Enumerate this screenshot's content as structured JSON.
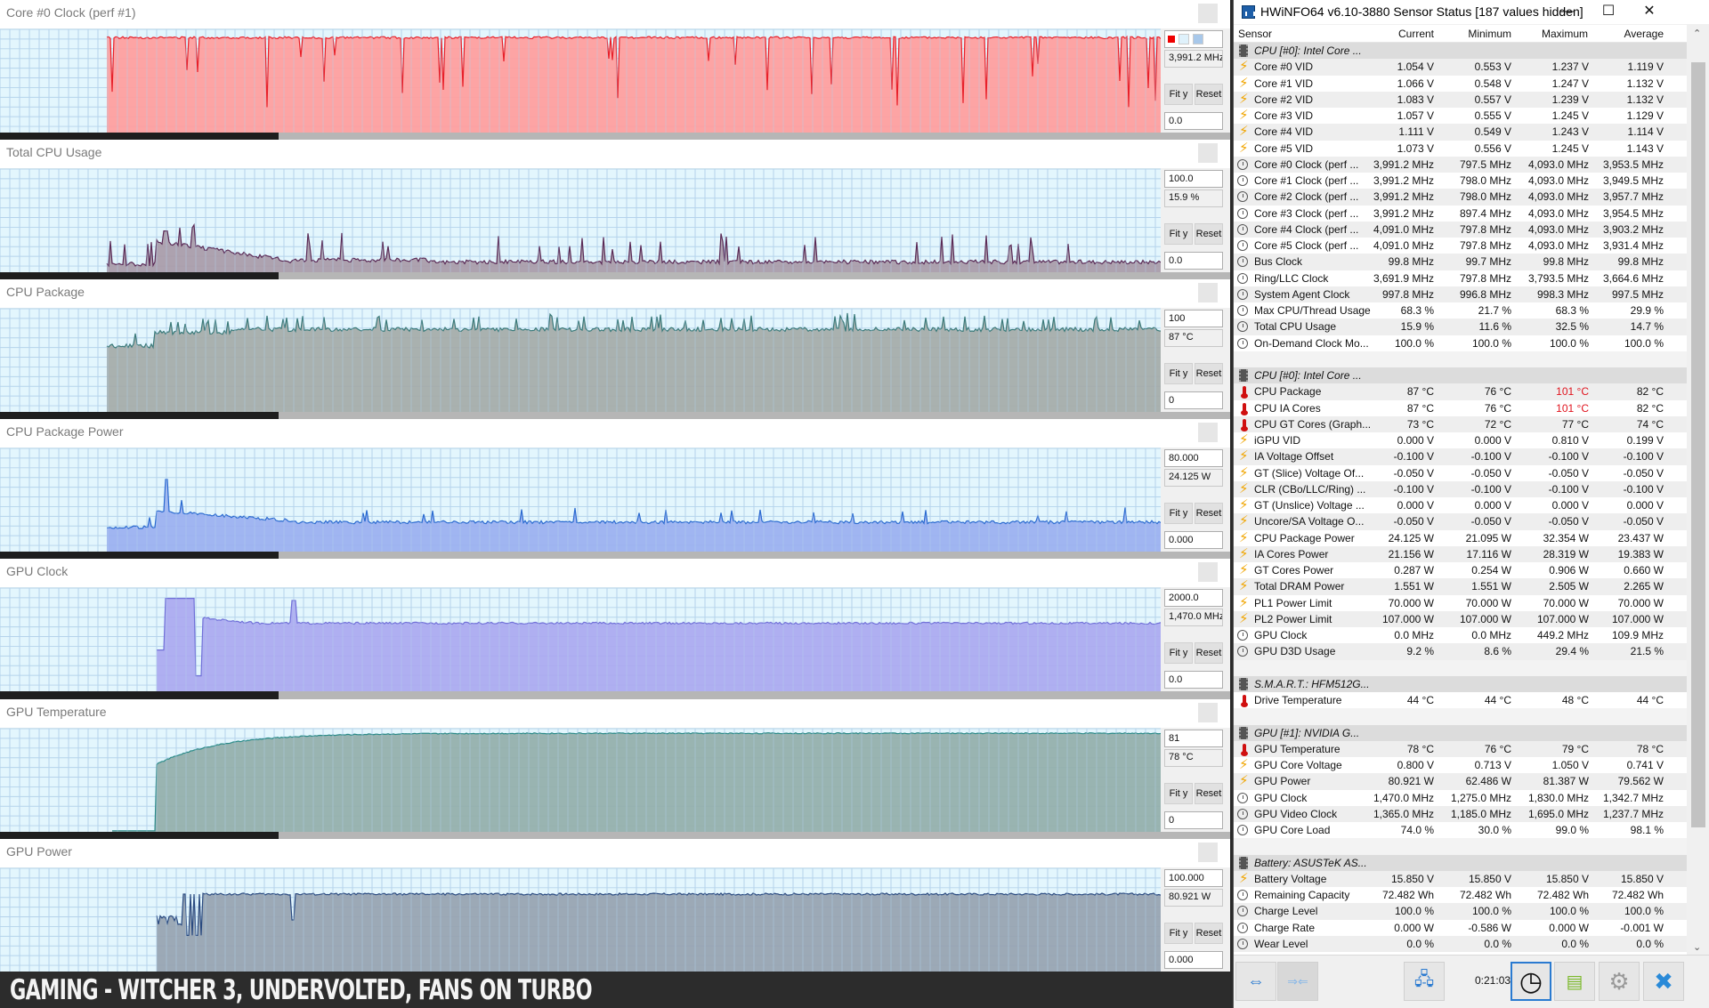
{
  "graphs": [
    {
      "title": "Core #0 Clock (perf #1)",
      "max": "",
      "current": "3,991.2 MHz",
      "min": "0.0",
      "fit_label": "Fit y",
      "reset_label": "Reset",
      "fill": "#ff9c9c",
      "line": "#e8202a",
      "series_kind": "clock",
      "has_color_swatch": true
    },
    {
      "title": "Total CPU Usage",
      "max": "100.0",
      "current": "15.9 %",
      "min": "0.0",
      "fit_label": "Fit y",
      "reset_label": "Reset",
      "fill": "#a89aa8",
      "line": "#5a2a56",
      "series_kind": "cpuusage"
    },
    {
      "title": "CPU Package",
      "max": "100",
      "current": "87 °C",
      "min": "0",
      "fit_label": "Fit y",
      "reset_label": "Reset",
      "fill": "#a4aaa8",
      "line": "#3a7a7a",
      "series_kind": "cputemp"
    },
    {
      "title": "CPU Package Power",
      "max": "80.000",
      "current": "24.125 W",
      "min": "0.000",
      "fit_label": "Fit y",
      "reset_label": "Reset",
      "fill": "#9aaff0",
      "line": "#2a6ad0",
      "series_kind": "cpupower"
    },
    {
      "title": "GPU Clock",
      "max": "2000.0",
      "current": "1,470.0 MHz",
      "min": "0.0",
      "fit_label": "Fit y",
      "reset_label": "Reset",
      "fill": "#aaa8f0",
      "line": "#7070d8",
      "series_kind": "gpuclock"
    },
    {
      "title": "GPU Temperature",
      "max": "81",
      "current": "78 °C",
      "min": "0",
      "fit_label": "Fit y",
      "reset_label": "Reset",
      "fill": "#93aeaa",
      "line": "#2a8a88",
      "series_kind": "gputemp"
    },
    {
      "title": "GPU Power",
      "max": "100.000",
      "current": "80.921 W",
      "min": "0.000",
      "fit_label": "Fit y",
      "reset_label": "Reset",
      "fill": "#96a2b0",
      "line": "#2a4a80",
      "series_kind": "gpupower"
    }
  ],
  "banner": {
    "text": "GAMING - WITCHER 3, UNDERVOLTED, FANS ON TURBO"
  },
  "hwinfo": {
    "title": "HWiNFO64 v6.10-3880 Sensor Status [187 values hidden]",
    "controls": {
      "minimize": "—",
      "maximize": "☐",
      "close": "✕"
    },
    "columns": [
      "Sensor",
      "Current",
      "Minimum",
      "Maximum",
      "Average"
    ],
    "rows": [
      {
        "type": "group",
        "icon": "chip",
        "label": "CPU [#0]: Intel Core ..."
      },
      {
        "icon": "bolt",
        "label": "Core #0 VID",
        "cur": "1.054 V",
        "min": "0.553 V",
        "max": "1.237 V",
        "avg": "1.119 V"
      },
      {
        "icon": "bolt",
        "label": "Core #1 VID",
        "cur": "1.066 V",
        "min": "0.548 V",
        "max": "1.247 V",
        "avg": "1.132 V"
      },
      {
        "icon": "bolt",
        "label": "Core #2 VID",
        "cur": "1.083 V",
        "min": "0.557 V",
        "max": "1.239 V",
        "avg": "1.132 V"
      },
      {
        "icon": "bolt",
        "label": "Core #3 VID",
        "cur": "1.057 V",
        "min": "0.555 V",
        "max": "1.245 V",
        "avg": "1.129 V"
      },
      {
        "icon": "bolt",
        "label": "Core #4 VID",
        "cur": "1.111 V",
        "min": "0.549 V",
        "max": "1.243 V",
        "avg": "1.114 V"
      },
      {
        "icon": "bolt",
        "label": "Core #5 VID",
        "cur": "1.073 V",
        "min": "0.556 V",
        "max": "1.245 V",
        "avg": "1.143 V"
      },
      {
        "icon": "clock",
        "label": "Core #0 Clock (perf ...",
        "cur": "3,991.2 MHz",
        "min": "797.5 MHz",
        "max": "4,093.0 MHz",
        "avg": "3,953.5 MHz"
      },
      {
        "icon": "clock",
        "label": "Core #1 Clock (perf ...",
        "cur": "3,991.2 MHz",
        "min": "798.0 MHz",
        "max": "4,093.0 MHz",
        "avg": "3,949.5 MHz"
      },
      {
        "icon": "clock",
        "label": "Core #2 Clock (perf ...",
        "cur": "3,991.2 MHz",
        "min": "798.0 MHz",
        "max": "4,093.0 MHz",
        "avg": "3,957.7 MHz"
      },
      {
        "icon": "clock",
        "label": "Core #3 Clock (perf ...",
        "cur": "3,991.2 MHz",
        "min": "897.4 MHz",
        "max": "4,093.0 MHz",
        "avg": "3,954.5 MHz"
      },
      {
        "icon": "clock",
        "label": "Core #4 Clock (perf ...",
        "cur": "4,091.0 MHz",
        "min": "797.8 MHz",
        "max": "4,093.0 MHz",
        "avg": "3,903.2 MHz"
      },
      {
        "icon": "clock",
        "label": "Core #5 Clock (perf ...",
        "cur": "4,091.0 MHz",
        "min": "797.8 MHz",
        "max": "4,093.0 MHz",
        "avg": "3,931.4 MHz"
      },
      {
        "icon": "clock",
        "label": "Bus Clock",
        "cur": "99.8 MHz",
        "min": "99.7 MHz",
        "max": "99.8 MHz",
        "avg": "99.8 MHz"
      },
      {
        "icon": "clock",
        "label": "Ring/LLC Clock",
        "cur": "3,691.9 MHz",
        "min": "797.8 MHz",
        "max": "3,793.5 MHz",
        "avg": "3,664.6 MHz"
      },
      {
        "icon": "clock",
        "label": "System Agent Clock",
        "cur": "997.8 MHz",
        "min": "996.8 MHz",
        "max": "998.3 MHz",
        "avg": "997.5 MHz"
      },
      {
        "icon": "clock",
        "label": "Max CPU/Thread Usage",
        "cur": "68.3 %",
        "min": "21.7 %",
        "max": "68.3 %",
        "avg": "29.9 %"
      },
      {
        "icon": "clock",
        "label": "Total CPU Usage",
        "cur": "15.9 %",
        "min": "11.6 %",
        "max": "32.5 %",
        "avg": "14.7 %"
      },
      {
        "icon": "clock",
        "label": "On-Demand Clock Mo...",
        "cur": "100.0 %",
        "min": "100.0 %",
        "max": "100.0 %",
        "avg": "100.0 %"
      },
      {
        "type": "blank"
      },
      {
        "type": "group",
        "icon": "chip",
        "label": "CPU [#0]: Intel Core ..."
      },
      {
        "icon": "therm",
        "label": "CPU Package",
        "cur": "87 °C",
        "min": "76 °C",
        "max": "101 °C",
        "avg": "82 °C",
        "max_alert": true
      },
      {
        "icon": "therm",
        "label": "CPU IA Cores",
        "cur": "87 °C",
        "min": "76 °C",
        "max": "101 °C",
        "avg": "82 °C",
        "max_alert": true
      },
      {
        "icon": "therm",
        "label": "CPU GT Cores (Graph...",
        "cur": "73 °C",
        "min": "72 °C",
        "max": "77 °C",
        "avg": "74 °C"
      },
      {
        "icon": "bolt",
        "label": "iGPU VID",
        "cur": "0.000 V",
        "min": "0.000 V",
        "max": "0.810 V",
        "avg": "0.199 V"
      },
      {
        "icon": "bolt",
        "label": "IA Voltage Offset",
        "cur": "-0.100 V",
        "min": "-0.100 V",
        "max": "-0.100 V",
        "avg": "-0.100 V"
      },
      {
        "icon": "bolt",
        "label": "GT (Slice) Voltage Of...",
        "cur": "-0.050 V",
        "min": "-0.050 V",
        "max": "-0.050 V",
        "avg": "-0.050 V"
      },
      {
        "icon": "bolt",
        "label": "CLR (CBo/LLC/Ring) ...",
        "cur": "-0.100 V",
        "min": "-0.100 V",
        "max": "-0.100 V",
        "avg": "-0.100 V"
      },
      {
        "icon": "bolt",
        "label": "GT (Unslice) Voltage ...",
        "cur": "0.000 V",
        "min": "0.000 V",
        "max": "0.000 V",
        "avg": "0.000 V"
      },
      {
        "icon": "bolt",
        "label": "Uncore/SA Voltage O...",
        "cur": "-0.050 V",
        "min": "-0.050 V",
        "max": "-0.050 V",
        "avg": "-0.050 V"
      },
      {
        "icon": "bolt",
        "label": "CPU Package Power",
        "cur": "24.125 W",
        "min": "21.095 W",
        "max": "32.354 W",
        "avg": "23.437 W"
      },
      {
        "icon": "bolt",
        "label": "IA Cores Power",
        "cur": "21.156 W",
        "min": "17.116 W",
        "max": "28.319 W",
        "avg": "19.383 W"
      },
      {
        "icon": "bolt",
        "label": "GT Cores Power",
        "cur": "0.287 W",
        "min": "0.254 W",
        "max": "0.906 W",
        "avg": "0.660 W"
      },
      {
        "icon": "bolt",
        "label": "Total DRAM Power",
        "cur": "1.551 W",
        "min": "1.551 W",
        "max": "2.505 W",
        "avg": "2.265 W"
      },
      {
        "icon": "bolt",
        "label": "PL1 Power Limit",
        "cur": "70.000 W",
        "min": "70.000 W",
        "max": "70.000 W",
        "avg": "70.000 W"
      },
      {
        "icon": "bolt",
        "label": "PL2 Power Limit",
        "cur": "107.000 W",
        "min": "107.000 W",
        "max": "107.000 W",
        "avg": "107.000 W"
      },
      {
        "icon": "clock",
        "label": "GPU Clock",
        "cur": "0.0 MHz",
        "min": "0.0 MHz",
        "max": "449.2 MHz",
        "avg": "109.9 MHz"
      },
      {
        "icon": "clock",
        "label": "GPU D3D Usage",
        "cur": "9.2 %",
        "min": "8.6 %",
        "max": "29.4 %",
        "avg": "21.5 %"
      },
      {
        "type": "blank"
      },
      {
        "type": "group",
        "icon": "chip",
        "label": "S.M.A.R.T.: HFM512G..."
      },
      {
        "icon": "therm",
        "label": "Drive Temperature",
        "cur": "44 °C",
        "min": "44 °C",
        "max": "48 °C",
        "avg": "44 °C"
      },
      {
        "type": "blank"
      },
      {
        "type": "group",
        "icon": "chip",
        "label": "GPU [#1]: NVIDIA G..."
      },
      {
        "icon": "therm",
        "label": "GPU Temperature",
        "cur": "78 °C",
        "min": "76 °C",
        "max": "79 °C",
        "avg": "78 °C"
      },
      {
        "icon": "bolt",
        "label": "GPU Core Voltage",
        "cur": "0.800 V",
        "min": "0.713 V",
        "max": "1.050 V",
        "avg": "0.741 V"
      },
      {
        "icon": "bolt",
        "label": "GPU Power",
        "cur": "80.921 W",
        "min": "62.486 W",
        "max": "81.387 W",
        "avg": "79.562 W"
      },
      {
        "icon": "clock",
        "label": "GPU Clock",
        "cur": "1,470.0 MHz",
        "min": "1,275.0 MHz",
        "max": "1,830.0 MHz",
        "avg": "1,342.7 MHz"
      },
      {
        "icon": "clock",
        "label": "GPU Video Clock",
        "cur": "1,365.0 MHz",
        "min": "1,185.0 MHz",
        "max": "1,695.0 MHz",
        "avg": "1,237.7 MHz"
      },
      {
        "icon": "clock",
        "label": "GPU Core Load",
        "cur": "74.0 %",
        "min": "30.0 %",
        "max": "99.0 %",
        "avg": "98.1 %"
      },
      {
        "type": "blank"
      },
      {
        "type": "group",
        "icon": "chip",
        "label": "Battery: ASUSTeK AS..."
      },
      {
        "icon": "bolt",
        "label": "Battery Voltage",
        "cur": "15.850 V",
        "min": "15.850 V",
        "max": "15.850 V",
        "avg": "15.850 V"
      },
      {
        "icon": "clock",
        "label": "Remaining Capacity",
        "cur": "72.482 Wh",
        "min": "72.482 Wh",
        "max": "72.482 Wh",
        "avg": "72.482 Wh"
      },
      {
        "icon": "clock",
        "label": "Charge Level",
        "cur": "100.0 %",
        "min": "100.0 %",
        "max": "100.0 %",
        "avg": "100.0 %"
      },
      {
        "icon": "clock",
        "label": "Charge Rate",
        "cur": "0.000 W",
        "min": "-0.586 W",
        "max": "0.000 W",
        "avg": "-0.001 W"
      },
      {
        "icon": "clock",
        "label": "Wear Level",
        "cur": "0.0 %",
        "min": "0.0 %",
        "max": "0.0 %",
        "avg": "0.0 %"
      }
    ],
    "toolbar": {
      "timer": "0:21:03",
      "buttons": [
        {
          "name": "expand-collapse-icon",
          "glyph": "⇔"
        },
        {
          "name": "collapse-icon",
          "glyph": "⇒⇐"
        },
        {
          "name": "network-icon",
          "glyph": "🖧"
        },
        {
          "name": "clock-reset-icon",
          "glyph": "◷"
        },
        {
          "name": "log-add-icon",
          "glyph": "▤"
        },
        {
          "name": "settings-gear-icon",
          "glyph": "⚙"
        },
        {
          "name": "close-x-icon",
          "glyph": "✖"
        }
      ]
    },
    "alert_color": "#e0141e"
  }
}
